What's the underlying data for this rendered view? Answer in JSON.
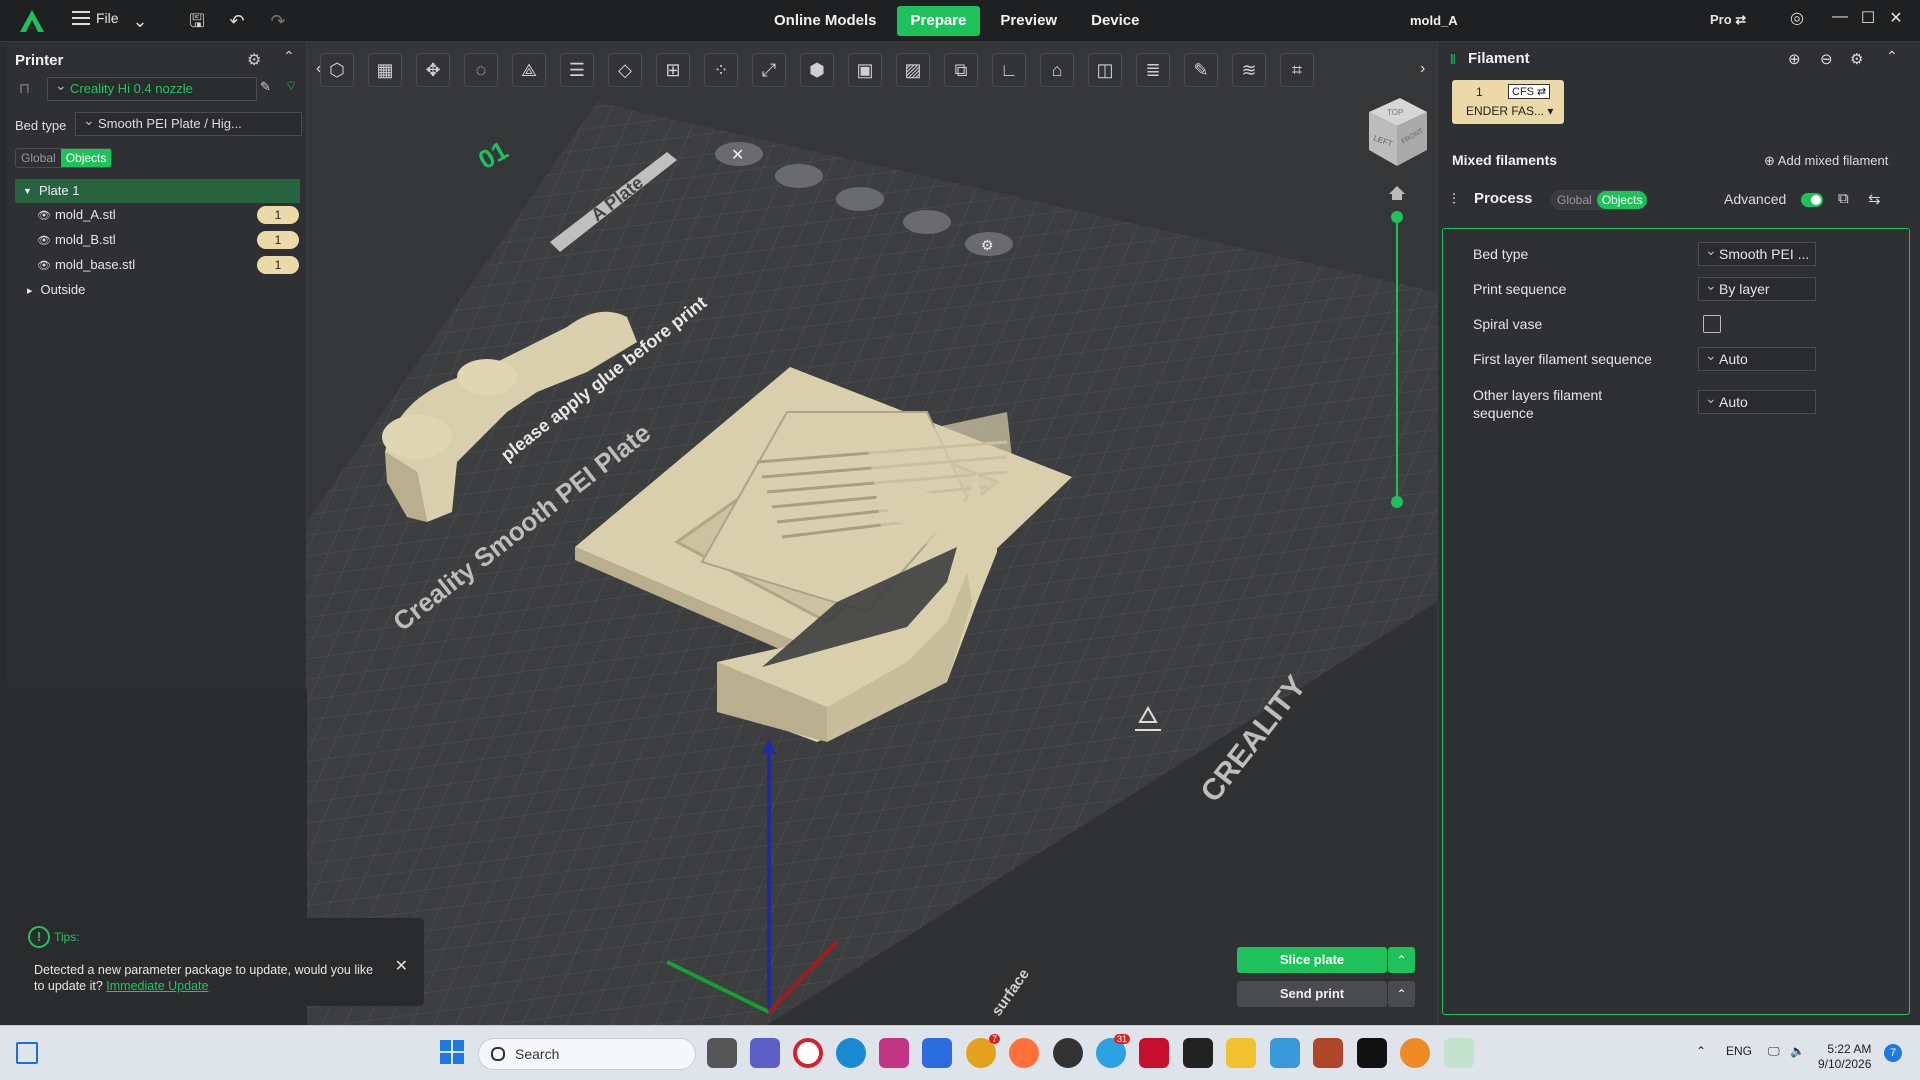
{
  "titlebar": {
    "file_label": "File",
    "nav": [
      "Online Models",
      "Prepare",
      "Preview",
      "Device"
    ],
    "active_nav": "Prepare",
    "project_title": "mold_A",
    "pro_label": "Pro ⇄",
    "icons": [
      "creality-logo-icon",
      "menu-icon",
      "chevron-down-icon",
      "save-icon",
      "undo-icon",
      "redo-icon",
      "support-icon",
      "minimize-icon",
      "maximize-icon",
      "close-icon"
    ]
  },
  "printer": {
    "title": "Printer",
    "printer_name": "Creality Hi 0.4 nozzle",
    "bed_type_label": "Bed type",
    "bed_type_value": "Smooth PEI Plate / Hig...",
    "global_label": "Global",
    "objects_label": "Objects"
  },
  "tree": {
    "plate": "Plate 1",
    "objects": [
      {
        "name": "mold_A.stl",
        "count": "1"
      },
      {
        "name": "mold_B.stl",
        "count": "1"
      },
      {
        "name": "mold_base.stl",
        "count": "1"
      }
    ],
    "outside": "Outside"
  },
  "plate_labels": {
    "plate_number": "01",
    "a_plate": "A Plate",
    "bed_text_1": "please apply glue before print",
    "bed_text_2": "Creality Smooth PEI Plate",
    "brand": "CREALITY",
    "cube_top": "TOP",
    "cube_left": "LEFT",
    "cube_front": "FRONT",
    "surface": "surface"
  },
  "filament": {
    "title": "Filament",
    "slot_number": "1",
    "cfs_label": "CFS ⇄",
    "filament_name": "ENDER FAS... ▾",
    "mixed_title": "Mixed filaments",
    "add_mixed": "Add mixed filament"
  },
  "process": {
    "title": "Process",
    "global_label": "Global",
    "objects_label": "Objects",
    "advanced_label": "Advanced",
    "props": [
      {
        "label": "Bed type",
        "value": "Smooth PEI ..."
      },
      {
        "label": "Print sequence",
        "value": "By layer"
      },
      {
        "label": "Spiral vase",
        "value": ""
      },
      {
        "label": "First layer filament sequence",
        "value": "Auto"
      },
      {
        "label": "Other layers filament sequence",
        "value": "Auto"
      }
    ]
  },
  "tips": {
    "title": "Tips:",
    "message": "Detected a new parameter package to update, would you like to update it?",
    "link": "Immediate Update"
  },
  "actions": {
    "slice": "Slice plate",
    "send": "Send print"
  },
  "taskbar": {
    "search_placeholder": "Search",
    "lang": "ENG",
    "time": "5:22 AM",
    "date": "9/10/2026",
    "notification_count": "7",
    "app_badge": "31"
  },
  "colors": {
    "accent": "#1ec15a",
    "model": "#d9cfac",
    "bed": "#3c3d3f"
  }
}
